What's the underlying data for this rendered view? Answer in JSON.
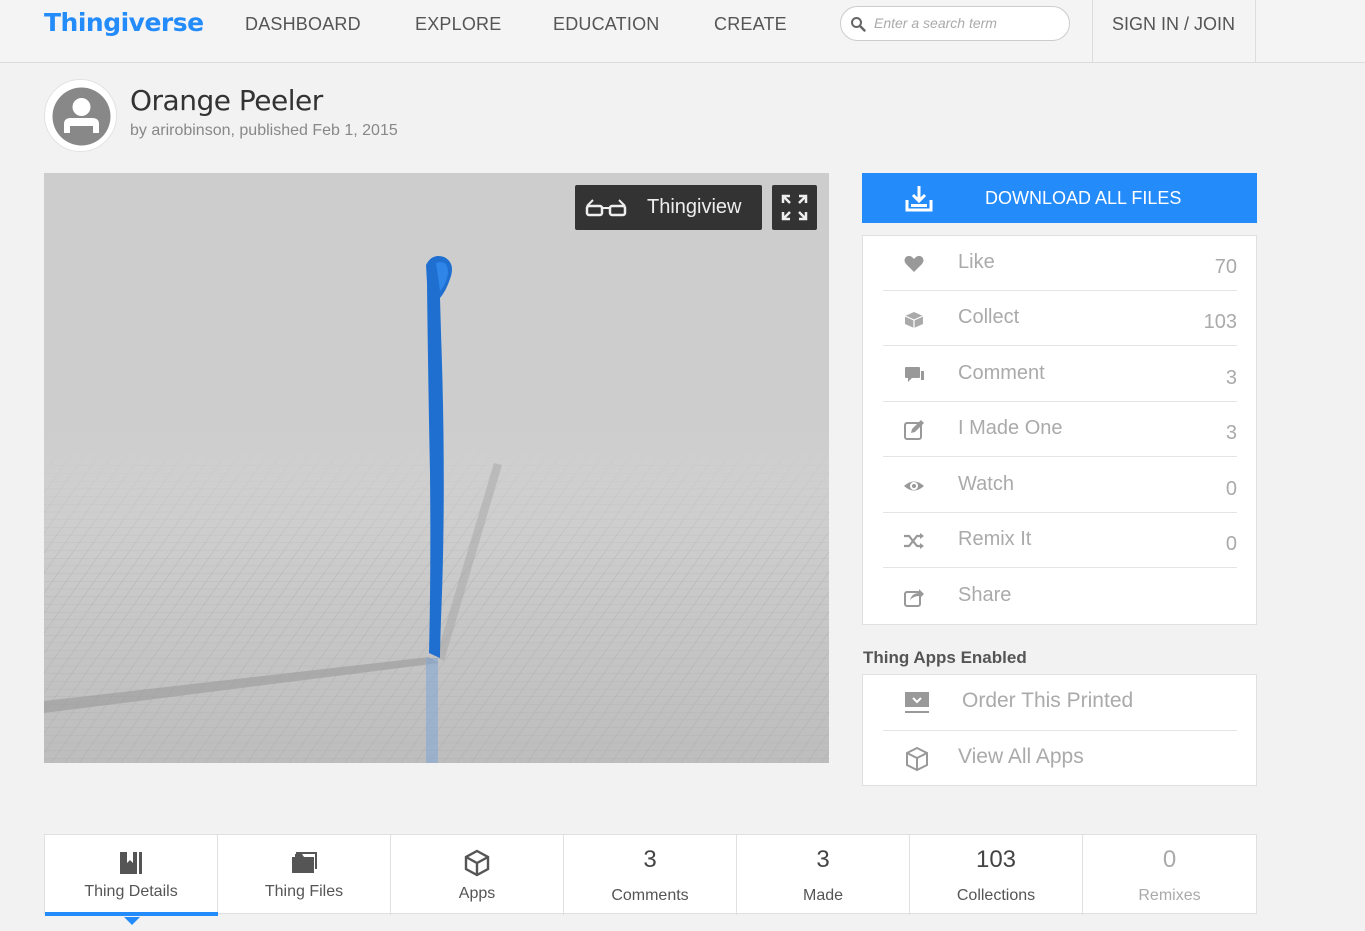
{
  "header": {
    "logo": "Thingiverse",
    "nav": [
      "DASHBOARD",
      "EXPLORE",
      "EDUCATION",
      "CREATE"
    ],
    "search_placeholder": "Enter a search term",
    "signin": "SIGN IN / JOIN"
  },
  "thing": {
    "title": "Orange Peeler",
    "byline": "by arirobinson, published Feb 1, 2015"
  },
  "viewer": {
    "thingiview_label": "Thingiview",
    "model_color": "#1e6fd0"
  },
  "download": {
    "label": "DOWNLOAD ALL FILES"
  },
  "actions": [
    {
      "icon": "heart-icon",
      "label": "Like",
      "count": "70"
    },
    {
      "icon": "collect-icon",
      "label": "Collect",
      "count": "103"
    },
    {
      "icon": "comment-icon",
      "label": "Comment",
      "count": "3"
    },
    {
      "icon": "made-icon",
      "label": "I Made One",
      "count": "3"
    },
    {
      "icon": "eye-icon",
      "label": "Watch",
      "count": "0"
    },
    {
      "icon": "remix-icon",
      "label": "Remix It",
      "count": "0"
    },
    {
      "icon": "share-icon",
      "label": "Share",
      "count": ""
    }
  ],
  "apps": {
    "heading": "Thing Apps Enabled",
    "items": [
      {
        "icon": "print-icon",
        "label": "Order This Printed"
      },
      {
        "icon": "cube-icon",
        "label": "View All Apps"
      }
    ]
  },
  "tabs": [
    {
      "label": "Thing Details"
    },
    {
      "label": "Thing Files"
    },
    {
      "label": "Apps"
    },
    {
      "number": "3",
      "label": "Comments"
    },
    {
      "number": "3",
      "label": "Made"
    },
    {
      "number": "103",
      "label": "Collections"
    },
    {
      "number": "0",
      "label": "Remixes"
    }
  ],
  "colors": {
    "accent": "#248bfb"
  }
}
